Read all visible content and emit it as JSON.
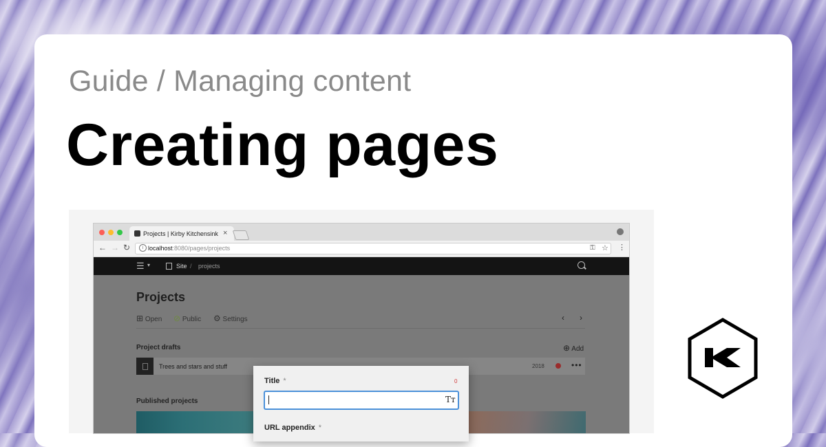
{
  "breadcrumb": "Guide / Managing content",
  "title": "Creating pages",
  "browser": {
    "tab_title": "Projects | Kirby Kitchensink",
    "tab_close": "×",
    "url_host": "localhost",
    "url_path": ":8080/pages/projects",
    "traffic_light_colors": [
      "#fc5f57",
      "#fdbc2e",
      "#33c748"
    ]
  },
  "panel": {
    "breadcrumb_site": "Site",
    "breadcrumb_separator": "/",
    "breadcrumb_page": "projects",
    "page_title": "Projects",
    "options": {
      "open": "Open",
      "status": "Public",
      "settings": "Settings"
    },
    "drafts_section": {
      "label": "Project drafts",
      "add": "Add",
      "items": [
        {
          "title": "Trees and stars and stuff",
          "year": "2018",
          "status_color": "#9a2c2c"
        }
      ]
    },
    "published_section": {
      "label": "Published projects"
    }
  },
  "dialog": {
    "title_label": "Title",
    "title_required": "*",
    "title_counter": "0",
    "title_value": "",
    "url_label": "URL appendix",
    "url_required": "*"
  },
  "icons": {
    "back": "←",
    "forward": "→",
    "reload": "↻",
    "info": "i",
    "key": "⚿",
    "star": "☆",
    "menu": "⋮",
    "hamburger": "☰",
    "chevron_down": "⌄",
    "open": "⊞",
    "status": "⊘",
    "settings": "⚙",
    "prev": "‹",
    "next": "›",
    "add": "⊕",
    "more": "•••",
    "text_format": "Tт"
  }
}
